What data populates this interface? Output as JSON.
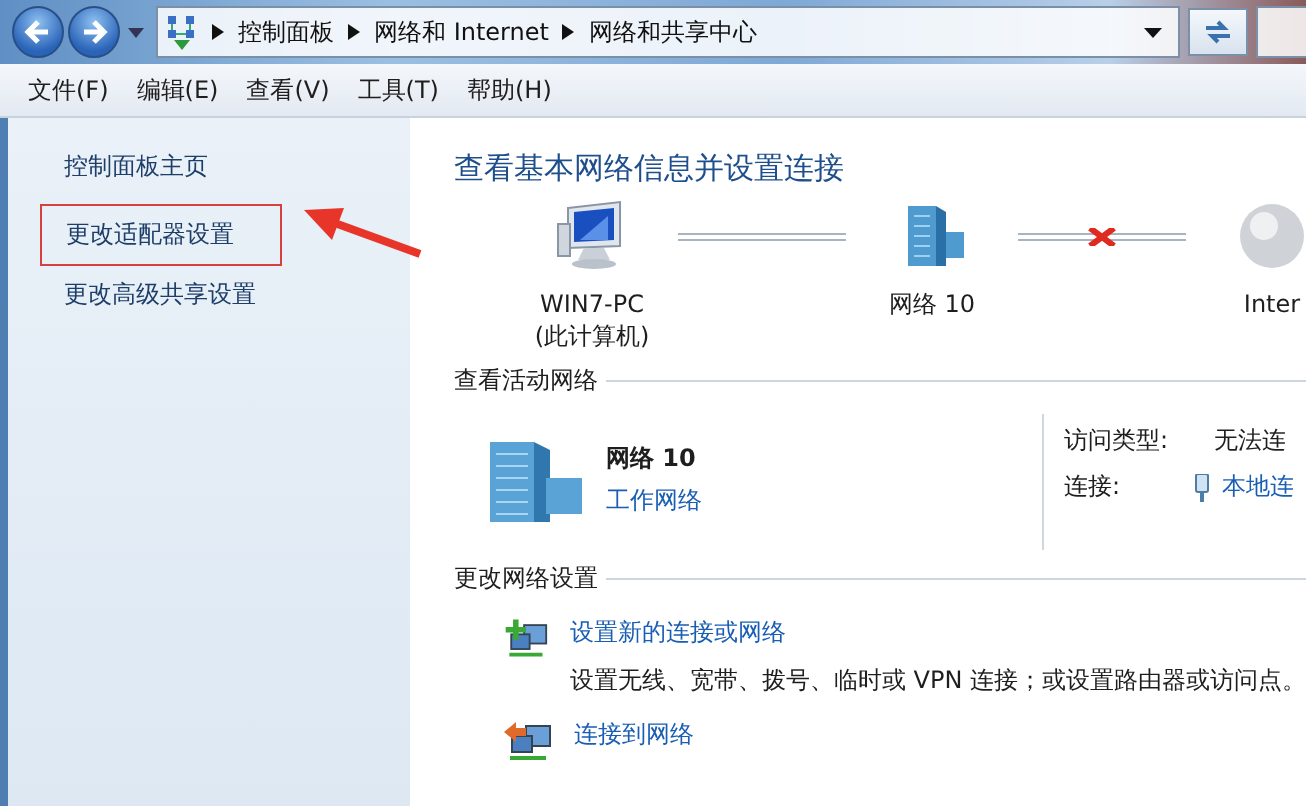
{
  "address_bar": {
    "breadcrumbs": [
      "控制面板",
      "网络和 Internet",
      "网络和共享中心"
    ]
  },
  "menu_bar": [
    "文件(F)",
    "编辑(E)",
    "查看(V)",
    "工具(T)",
    "帮助(H)"
  ],
  "sidebar": {
    "items": [
      {
        "label": "控制面板主页",
        "highlighted": false
      },
      {
        "label": "更改适配器设置",
        "highlighted": true
      },
      {
        "label": "更改高级共享设置",
        "highlighted": false
      }
    ]
  },
  "main": {
    "title": "查看基本网络信息并设置连接",
    "network_map": {
      "nodes": [
        {
          "kind": "computer",
          "label": "WIN7-PC",
          "sublabel": "(此计算机)"
        },
        {
          "kind": "network",
          "label": "网络  10"
        },
        {
          "kind": "internet",
          "label": "Inter"
        }
      ],
      "links": [
        {
          "broken": false
        },
        {
          "broken": true
        }
      ]
    },
    "active_networks": {
      "heading": "查看活动网络",
      "network": {
        "name": "网络  10",
        "type": "工作网络"
      },
      "details": [
        {
          "kind": "text",
          "label": "访问类型:",
          "value": "无法连"
        },
        {
          "kind": "link",
          "label": "连接:",
          "value": "本地连"
        }
      ]
    },
    "change_settings": {
      "heading": "更改网络设置",
      "tasks": [
        {
          "kind": "new",
          "title": "设置新的连接或网络",
          "description": "设置无线、宽带、拨号、临时或 VPN 连接；或设置路由器或访问点。"
        },
        {
          "kind": "connect",
          "title": "连接到网络"
        }
      ]
    }
  }
}
